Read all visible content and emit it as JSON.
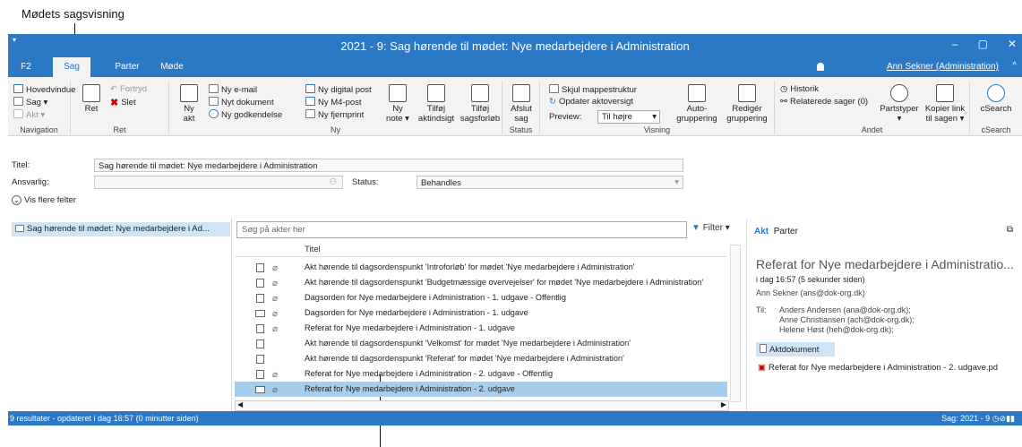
{
  "callouts": {
    "top": "Mødets sagsvisning"
  },
  "window": {
    "title": "2021 - 9: Sag hørende til mødet: Nye medarbejdere i Administration",
    "controls": [
      "–",
      "▢",
      "✕"
    ]
  },
  "tabs": [
    {
      "label": "F2"
    },
    {
      "label": "Sag"
    },
    {
      "label": "Parter"
    },
    {
      "label": "Møde"
    }
  ],
  "user": "Ann Sekner (Administration)",
  "ribbon": {
    "navigation": {
      "items": [
        "Hovedvindue",
        "Sag ▾",
        "Akt ▾"
      ],
      "label": "Navigation"
    },
    "ret": {
      "ret": "Ret",
      "fortryd": "Fortryd",
      "slet": "Slet",
      "label": "Ret"
    },
    "ny": {
      "ny_akt_1": "Ny",
      "ny_akt_2": "akt",
      "email": "Ny e-mail",
      "dokument": "Nyt dokument",
      "godkendelse": "Ny godkendelse",
      "digital_post": "Ny digital post",
      "m4_post": "Ny M4-post",
      "fjernprint": "Ny fjernprint",
      "ny_note_1": "Ny",
      "ny_note_2": "note ▾",
      "tilfoj_akt_1": "Tilføj",
      "tilfoj_akt_2": "aktindsigt",
      "tilfoj_sag_1": "Tilføj",
      "tilfoj_sag_2": "sagsforløb",
      "label": "Ny"
    },
    "status": {
      "afslut_1": "Afslut",
      "afslut_2": "sag",
      "label": "Status"
    },
    "visning": {
      "skjul": "Skjul mappestruktur",
      "opdater": "Opdater aktoversigt",
      "preview_label": "Preview:",
      "preview_value": "Til højre",
      "auto_1": "Auto-",
      "auto_2": "gruppering",
      "rediger_1": "Redigér",
      "rediger_2": "gruppering",
      "label": "Visning"
    },
    "andet": {
      "historik": "Historik",
      "relaterede": "Relaterede sager (0)",
      "partstyper_1": "Partstyper",
      "partstyper_2": "▾",
      "kopier_1": "Kopier link",
      "kopier_2": "til sagen ▾",
      "label": "Andet"
    },
    "csearch": {
      "btn": "cSearch",
      "label": "cSearch"
    }
  },
  "fields": {
    "titel_label": "Titel:",
    "titel_value": "Sag hørende til mødet: Nye medarbejdere i Administration",
    "ansvarlig_label": "Ansvarlig:",
    "status_label": "Status:",
    "status_value": "Behandles",
    "more": "Vis flere felter"
  },
  "tree": {
    "item": "Sag hørende til mødet: Nye medarbejdere i Ad..."
  },
  "list": {
    "search_placeholder": "Søg på akter her",
    "filter": "Filter",
    "col_title": "Titel",
    "rows": [
      {
        "title": "Akt hørende til dagsordenspunkt 'Introforløb' for mødet 'Nye medarbejdere i Administration'",
        "icon": "doc",
        "clip": true
      },
      {
        "title": "Akt hørende til dagsordenspunkt 'Budgetmæssige overvejelser' for mødet 'Nye medarbejdere i Administration'",
        "icon": "doc",
        "clip": true
      },
      {
        "title": "Dagsorden for Nye medarbejdere i Administration - 1. udgave - Offentlig",
        "icon": "doc",
        "clip": true
      },
      {
        "title": "Dagsorden for Nye medarbejdere i Administration - 1. udgave",
        "icon": "mail",
        "clip": true
      },
      {
        "title": "Referat for Nye medarbejdere i Administration - 1. udgave",
        "icon": "doc",
        "clip": true
      },
      {
        "title": "Akt hørende til dagsordenspunkt 'Velkomst' for mødet 'Nye medarbejdere i Administration'",
        "icon": "doc",
        "clip": false
      },
      {
        "title": "Akt hørende til dagsordenspunkt 'Referat' for mødet 'Nye medarbejdere i Administration'",
        "icon": "doc",
        "clip": false
      },
      {
        "title": "Referat for Nye medarbejdere i Administration - 2. udgave - Offentlig",
        "icon": "doc",
        "clip": true
      },
      {
        "title": "Referat for Nye medarbejdere i Administration - 2. udgave",
        "icon": "mail",
        "clip": true,
        "selected": true
      }
    ]
  },
  "preview": {
    "tab_akt": "Akt",
    "tab_parter": "Parter",
    "heading": "Referat for Nye medarbejdere i Administratio...",
    "time": "i dag 16:57 (5 sekunder siden)",
    "sender": "Ann Sekner (ans@dok-org.dk)",
    "to_label": "Til:",
    "recipients": [
      "Anders Andersen (ana@dok-org.dk);",
      "Anne Christiansen (ach@dok-org.dk);",
      "Helene Høst (heh@dok-org.dk);"
    ],
    "attachment_label": "Aktdokument",
    "attachment_file": "Referat for Nye medarbejdere i Administration - 2. udgave.pd"
  },
  "status": {
    "left": "9 resultater - opdateret i dag 16:57 (0 minutter siden)",
    "right": "Sag: 2021 - 9"
  },
  "colors": {
    "accent": "#2b78c5",
    "selection": "#a8cdea"
  }
}
